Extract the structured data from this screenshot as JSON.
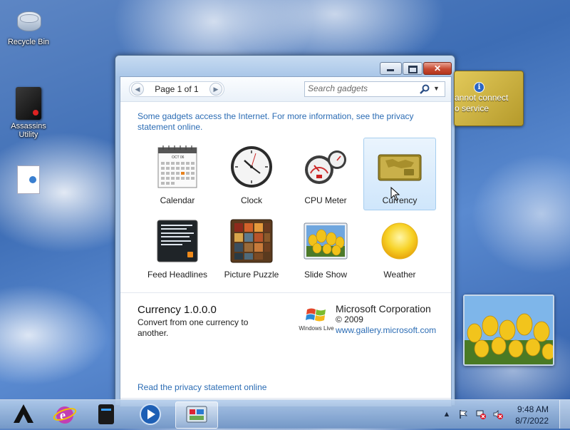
{
  "desktop": {
    "icons": [
      {
        "label": "Recycle Bin"
      },
      {
        "label": "Assassins Utility"
      },
      {
        "label": ""
      }
    ]
  },
  "window": {
    "pager": {
      "label": "Page 1 of 1"
    },
    "search": {
      "placeholder": "Search gadgets"
    },
    "notice": "Some gadgets access the Internet.  For more information, see the privacy statement online.",
    "gadgets": [
      {
        "label": "Calendar"
      },
      {
        "label": "Clock"
      },
      {
        "label": "CPU Meter"
      },
      {
        "label": "Currency",
        "selected": true
      },
      {
        "label": "Feed Headlines"
      },
      {
        "label": "Picture Puzzle"
      },
      {
        "label": "Slide Show"
      },
      {
        "label": "Weather"
      }
    ],
    "calendar_month": "OCT 06",
    "details": {
      "title": "Currency 1.0.0.0",
      "description": "Convert from one currency to another.",
      "publisher": "Microsoft Corporation",
      "year": "© 2009",
      "url": "www.gallery.microsoft.com",
      "logo_text": "Windows Live"
    },
    "privacy_link": "Read the privacy statement online"
  },
  "currency_widget": {
    "message": "annot connect\no service"
  },
  "taskbar": {
    "items": [
      "assassins-app",
      "internet-explorer",
      "drive-app",
      "media-player",
      "gadgets"
    ],
    "clock": {
      "time": "9:48 AM",
      "date": "8/7/2022"
    }
  },
  "colors": {
    "link": "#2b6cb4",
    "selection": "#cfe6fb",
    "close": "#c74a32"
  }
}
